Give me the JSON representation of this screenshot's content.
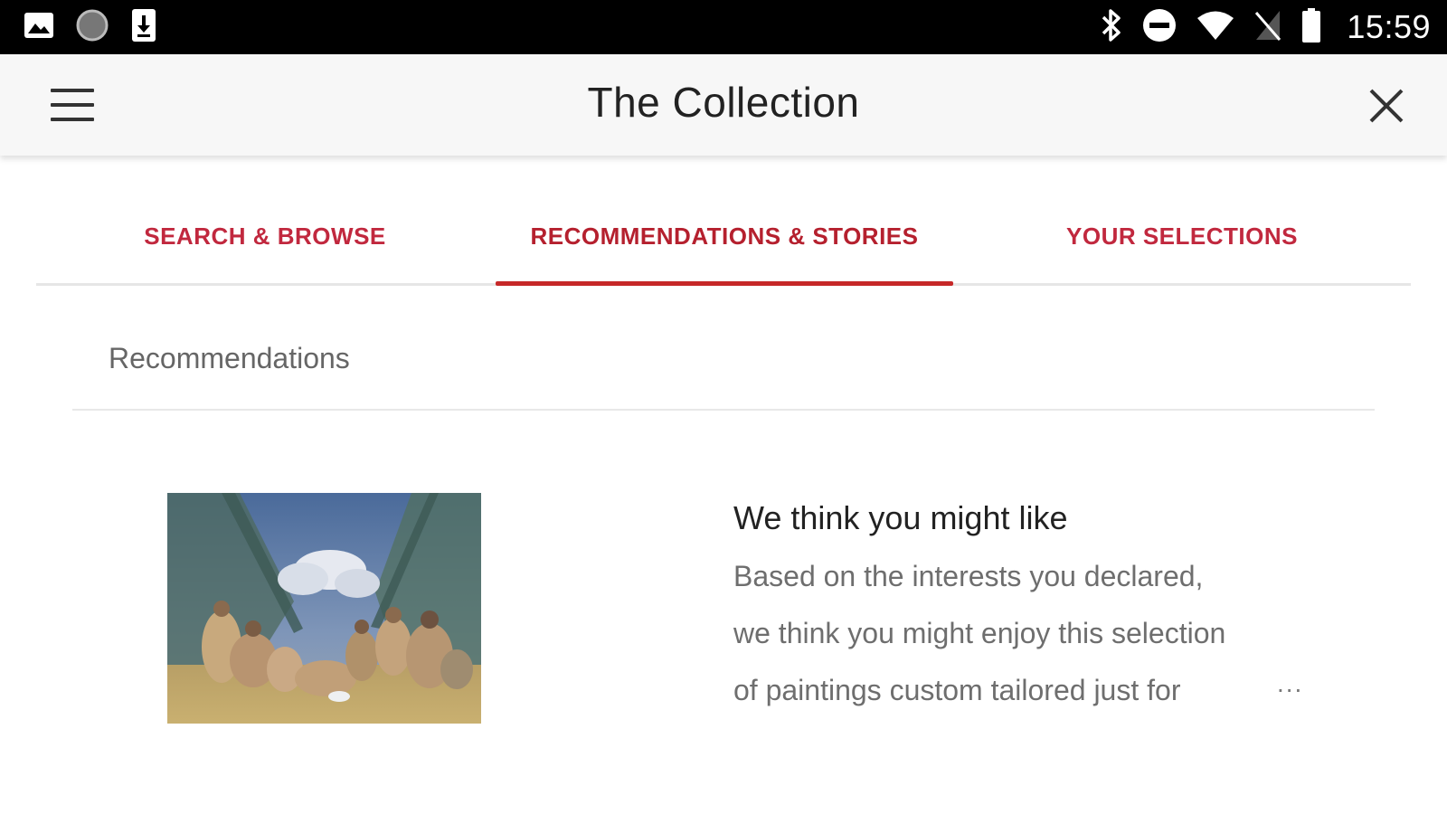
{
  "status_bar": {
    "time": "15:59",
    "left_icons": [
      "image-icon",
      "circle-icon",
      "download-icon"
    ],
    "right_icons": [
      "bluetooth-icon",
      "do-not-disturb-icon",
      "wifi-icon",
      "no-sim-icon",
      "battery-icon"
    ]
  },
  "app_bar": {
    "title": "The Collection",
    "menu_icon": "hamburger-menu-icon",
    "close_icon": "close-icon"
  },
  "tabs": [
    {
      "label": "SEARCH & BROWSE",
      "active": false
    },
    {
      "label": "RECOMMENDATIONS & STORIES",
      "active": true
    },
    {
      "label": "YOUR SELECTIONS",
      "active": false
    }
  ],
  "colors": {
    "accent": "#c62828",
    "tab_text": "#c1283e",
    "status_bar": "#000000",
    "app_bar": "#f7f7f7"
  },
  "section": {
    "title": "Recommendations"
  },
  "card": {
    "title": "We think you might like",
    "description_lines": [
      "Based on the interests you declared,",
      "we think you might enjoy this selection",
      "of paintings custom tailored just for"
    ],
    "more": "..."
  }
}
